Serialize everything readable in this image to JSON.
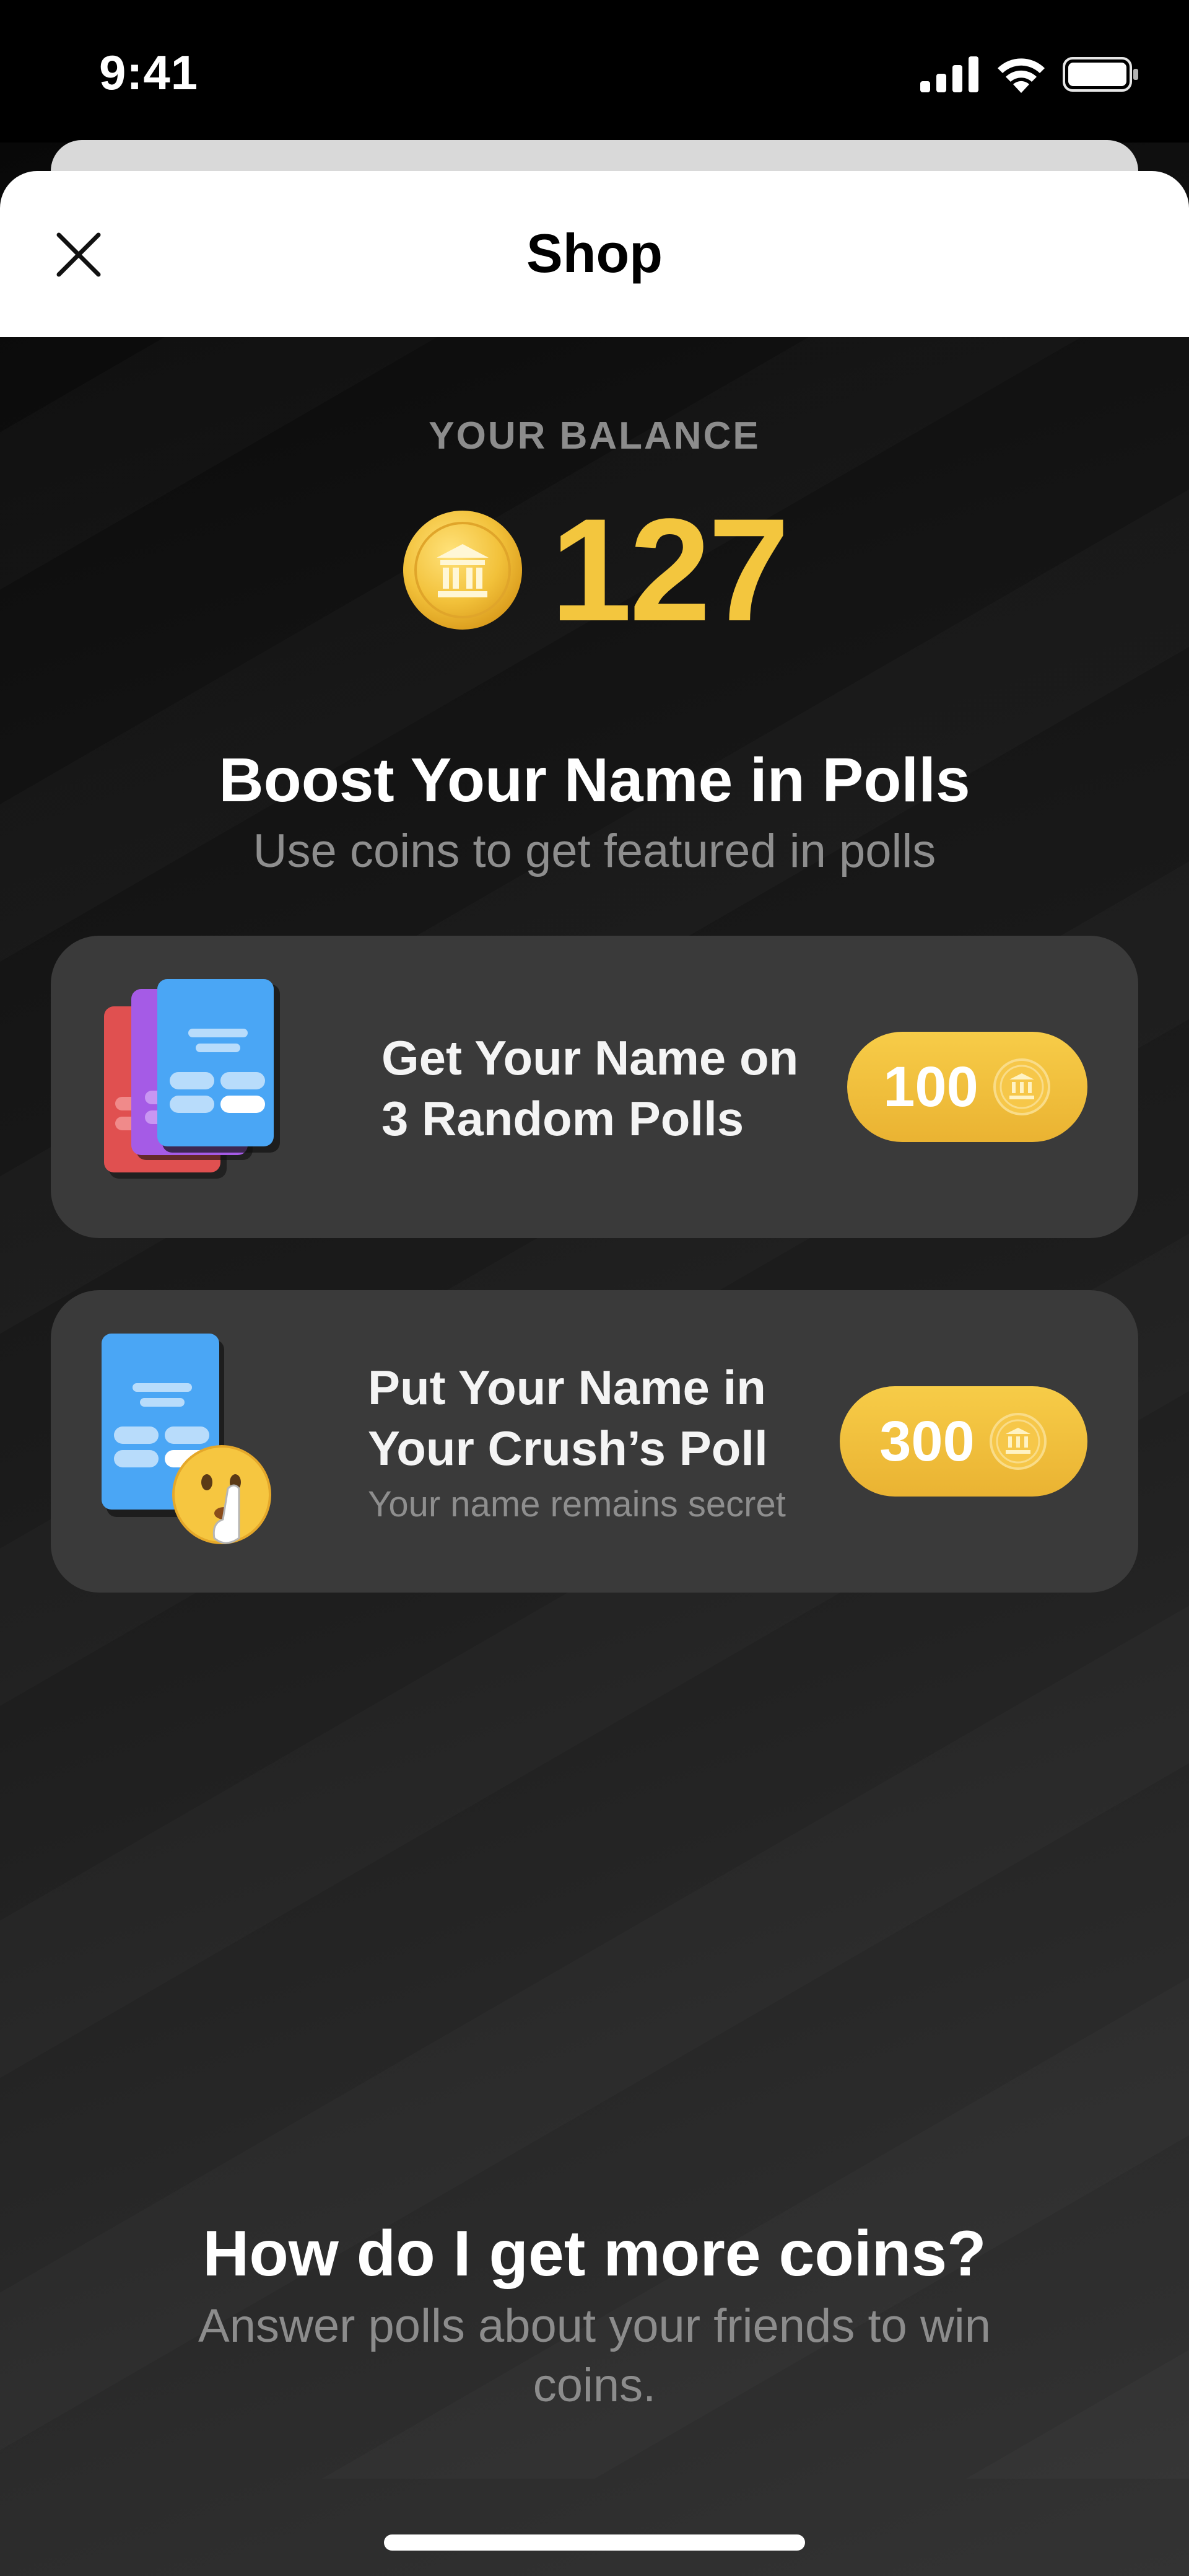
{
  "status_bar": {
    "time": "9:41"
  },
  "header": {
    "title": "Shop"
  },
  "balance": {
    "label": "YOUR BALANCE",
    "value": "127"
  },
  "boost": {
    "title": "Boost Your Name in Polls",
    "subtitle": "Use coins to get featured in polls"
  },
  "offers": [
    {
      "title_line1": "Get Your Name on",
      "title_line2": "3 Random Polls",
      "subtitle": "",
      "price": "100",
      "icon": "stacked-polls-icon"
    },
    {
      "title_line1": "Put Your Name in",
      "title_line2": "Your Crush’s Poll",
      "subtitle": "Your name remains secret",
      "price": "300",
      "icon": "secret-poll-icon"
    }
  ],
  "faq": {
    "title": "How do I get more coins?",
    "text": "Answer polls about your friends to win coins."
  },
  "colors": {
    "coin_gold": "#f3c63e",
    "card_bg": "#3a3a3a",
    "muted_text": "#8c8c8c"
  }
}
